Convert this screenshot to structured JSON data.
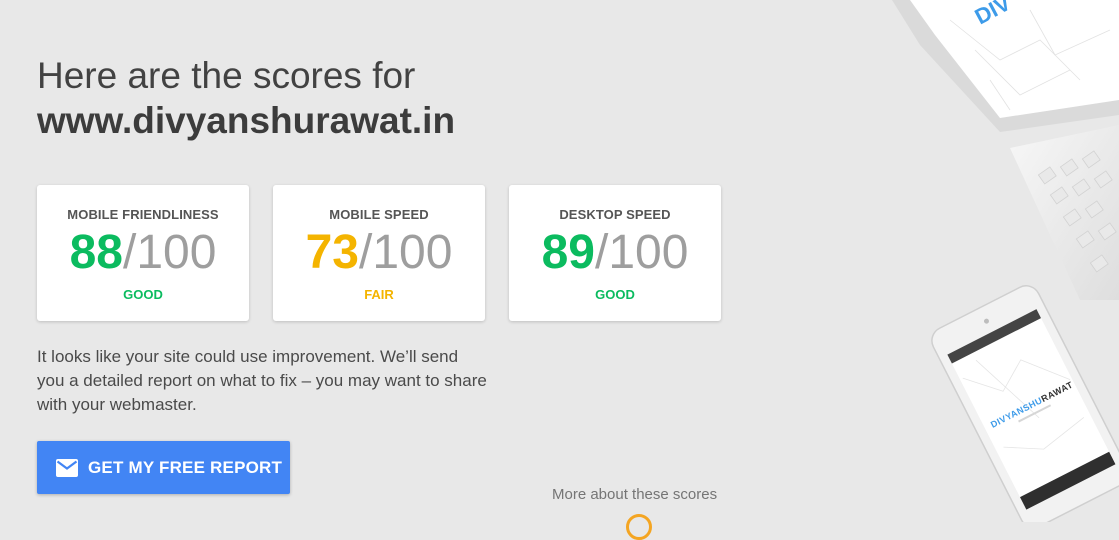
{
  "header": {
    "line1": "Here are the scores for",
    "domain": "www.divyanshurawat.in"
  },
  "cards": [
    {
      "label": "MOBILE FRIENDLINESS",
      "score": "88",
      "max": "/100",
      "rating": "GOOD",
      "color": "#0bbb5f"
    },
    {
      "label": "MOBILE SPEED",
      "score": "73",
      "max": "/100",
      "rating": "FAIR",
      "color": "#f4b400"
    },
    {
      "label": "DESKTOP SPEED",
      "score": "89",
      "max": "/100",
      "rating": "GOOD",
      "color": "#0bbb5f"
    }
  ],
  "description": "It looks like your site could use improvement. We’ll send you a detailed report on what to fix – you may want to share with your webmaster.",
  "cta": {
    "label": "GET MY FREE REPORT",
    "icon": "mail-icon",
    "color": "#4285f4"
  },
  "more_link": "More about these scores",
  "illustration": {
    "tablet_text": "DIV",
    "phone_brand_blue": "DIVYANSHU",
    "phone_brand_dark": "RAWAT"
  }
}
